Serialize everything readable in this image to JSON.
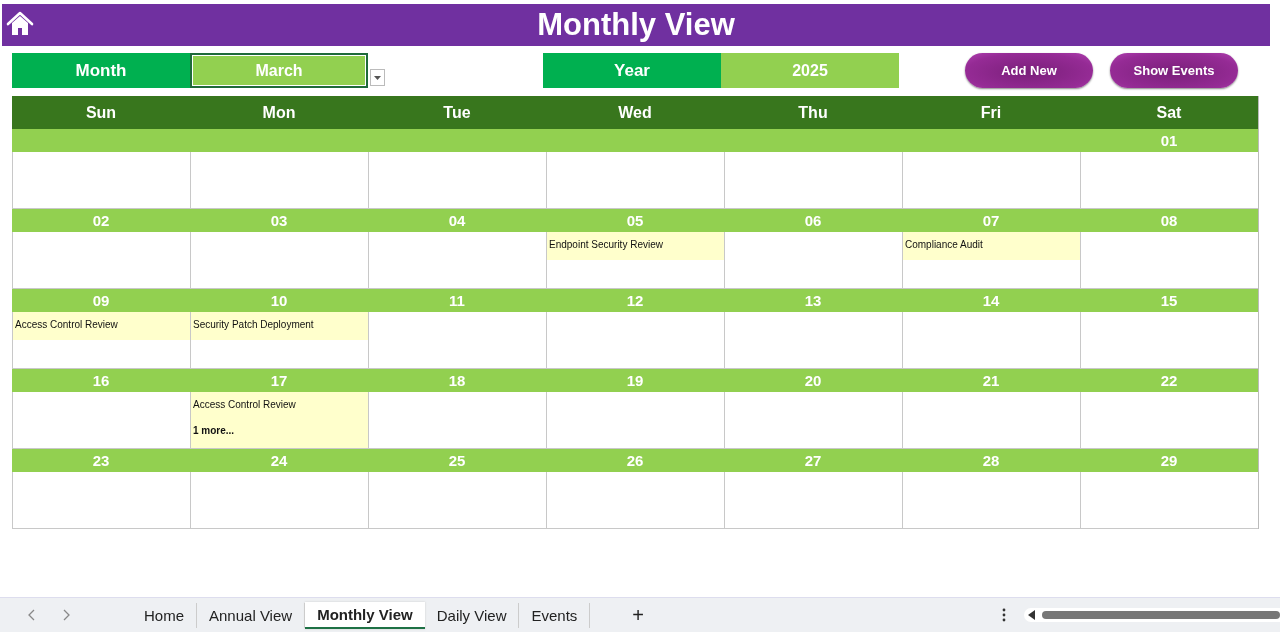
{
  "title": "Monthly View",
  "controls": {
    "month_label": "Month",
    "month_value": "March",
    "year_label": "Year",
    "year_value": "2025",
    "buttons": [
      "Add New",
      "Show Events"
    ]
  },
  "weekdays": [
    "Sun",
    "Mon",
    "Tue",
    "Wed",
    "Thu",
    "Fri",
    "Sat"
  ],
  "weeks": [
    [
      {
        "kind": "blank"
      },
      {
        "kind": "blank"
      },
      {
        "kind": "blank"
      },
      {
        "kind": "blank"
      },
      {
        "kind": "blank"
      },
      {
        "kind": "blank"
      },
      {
        "kind": "day",
        "date": "01"
      }
    ],
    [
      {
        "date": "02"
      },
      {
        "date": "03"
      },
      {
        "date": "04"
      },
      {
        "date": "05",
        "events": [
          "Endpoint Security Review"
        ]
      },
      {
        "date": "06"
      },
      {
        "date": "07",
        "events": [
          "Compliance Audit"
        ]
      },
      {
        "date": "08"
      }
    ],
    [
      {
        "date": "09",
        "events": [
          "Access Control Review"
        ]
      },
      {
        "date": "10",
        "events": [
          "Security Patch Deployment"
        ]
      },
      {
        "date": "11"
      },
      {
        "date": "12"
      },
      {
        "date": "13"
      },
      {
        "date": "14"
      },
      {
        "date": "15"
      }
    ],
    [
      {
        "date": "16"
      },
      {
        "date": "17",
        "events": [
          "Access Control Review"
        ],
        "more": "1 more..."
      },
      {
        "date": "18"
      },
      {
        "date": "19"
      },
      {
        "date": "20"
      },
      {
        "date": "21"
      },
      {
        "date": "22"
      }
    ],
    [
      {
        "date": "23"
      },
      {
        "date": "24"
      },
      {
        "date": "25"
      },
      {
        "date": "26"
      },
      {
        "date": "27"
      },
      {
        "date": "28"
      },
      {
        "date": "29"
      }
    ]
  ],
  "sheet_tabs": [
    {
      "label": "Home",
      "selected": false
    },
    {
      "label": "Annual View",
      "selected": false
    },
    {
      "label": "Monthly View",
      "selected": true
    },
    {
      "label": "Daily View",
      "selected": false
    },
    {
      "label": "Events",
      "selected": false
    }
  ],
  "add_sheet": "+"
}
